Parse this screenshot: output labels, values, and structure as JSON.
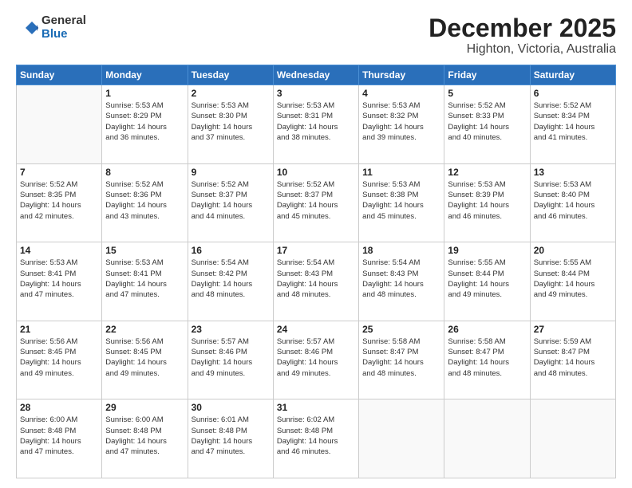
{
  "header": {
    "logo_general": "General",
    "logo_blue": "Blue",
    "month_year": "December 2025",
    "location": "Highton, Victoria, Australia"
  },
  "calendar": {
    "days_of_week": [
      "Sunday",
      "Monday",
      "Tuesday",
      "Wednesday",
      "Thursday",
      "Friday",
      "Saturday"
    ],
    "weeks": [
      [
        {
          "day": "",
          "empty": true
        },
        {
          "day": "1",
          "sunrise": "5:53 AM",
          "sunset": "8:29 PM",
          "daylight": "14 hours and 36 minutes."
        },
        {
          "day": "2",
          "sunrise": "5:53 AM",
          "sunset": "8:30 PM",
          "daylight": "14 hours and 37 minutes."
        },
        {
          "day": "3",
          "sunrise": "5:53 AM",
          "sunset": "8:31 PM",
          "daylight": "14 hours and 38 minutes."
        },
        {
          "day": "4",
          "sunrise": "5:53 AM",
          "sunset": "8:32 PM",
          "daylight": "14 hours and 39 minutes."
        },
        {
          "day": "5",
          "sunrise": "5:52 AM",
          "sunset": "8:33 PM",
          "daylight": "14 hours and 40 minutes."
        },
        {
          "day": "6",
          "sunrise": "5:52 AM",
          "sunset": "8:34 PM",
          "daylight": "14 hours and 41 minutes."
        }
      ],
      [
        {
          "day": "7",
          "sunrise": "5:52 AM",
          "sunset": "8:35 PM",
          "daylight": "14 hours and 42 minutes."
        },
        {
          "day": "8",
          "sunrise": "5:52 AM",
          "sunset": "8:36 PM",
          "daylight": "14 hours and 43 minutes."
        },
        {
          "day": "9",
          "sunrise": "5:52 AM",
          "sunset": "8:37 PM",
          "daylight": "14 hours and 44 minutes."
        },
        {
          "day": "10",
          "sunrise": "5:52 AM",
          "sunset": "8:37 PM",
          "daylight": "14 hours and 45 minutes."
        },
        {
          "day": "11",
          "sunrise": "5:53 AM",
          "sunset": "8:38 PM",
          "daylight": "14 hours and 45 minutes."
        },
        {
          "day": "12",
          "sunrise": "5:53 AM",
          "sunset": "8:39 PM",
          "daylight": "14 hours and 46 minutes."
        },
        {
          "day": "13",
          "sunrise": "5:53 AM",
          "sunset": "8:40 PM",
          "daylight": "14 hours and 46 minutes."
        }
      ],
      [
        {
          "day": "14",
          "sunrise": "5:53 AM",
          "sunset": "8:41 PM",
          "daylight": "14 hours and 47 minutes."
        },
        {
          "day": "15",
          "sunrise": "5:53 AM",
          "sunset": "8:41 PM",
          "daylight": "14 hours and 47 minutes."
        },
        {
          "day": "16",
          "sunrise": "5:54 AM",
          "sunset": "8:42 PM",
          "daylight": "14 hours and 48 minutes."
        },
        {
          "day": "17",
          "sunrise": "5:54 AM",
          "sunset": "8:43 PM",
          "daylight": "14 hours and 48 minutes."
        },
        {
          "day": "18",
          "sunrise": "5:54 AM",
          "sunset": "8:43 PM",
          "daylight": "14 hours and 48 minutes."
        },
        {
          "day": "19",
          "sunrise": "5:55 AM",
          "sunset": "8:44 PM",
          "daylight": "14 hours and 49 minutes."
        },
        {
          "day": "20",
          "sunrise": "5:55 AM",
          "sunset": "8:44 PM",
          "daylight": "14 hours and 49 minutes."
        }
      ],
      [
        {
          "day": "21",
          "sunrise": "5:56 AM",
          "sunset": "8:45 PM",
          "daylight": "14 hours and 49 minutes."
        },
        {
          "day": "22",
          "sunrise": "5:56 AM",
          "sunset": "8:45 PM",
          "daylight": "14 hours and 49 minutes."
        },
        {
          "day": "23",
          "sunrise": "5:57 AM",
          "sunset": "8:46 PM",
          "daylight": "14 hours and 49 minutes."
        },
        {
          "day": "24",
          "sunrise": "5:57 AM",
          "sunset": "8:46 PM",
          "daylight": "14 hours and 49 minutes."
        },
        {
          "day": "25",
          "sunrise": "5:58 AM",
          "sunset": "8:47 PM",
          "daylight": "14 hours and 48 minutes."
        },
        {
          "day": "26",
          "sunrise": "5:58 AM",
          "sunset": "8:47 PM",
          "daylight": "14 hours and 48 minutes."
        },
        {
          "day": "27",
          "sunrise": "5:59 AM",
          "sunset": "8:47 PM",
          "daylight": "14 hours and 48 minutes."
        }
      ],
      [
        {
          "day": "28",
          "sunrise": "6:00 AM",
          "sunset": "8:48 PM",
          "daylight": "14 hours and 47 minutes."
        },
        {
          "day": "29",
          "sunrise": "6:00 AM",
          "sunset": "8:48 PM",
          "daylight": "14 hours and 47 minutes."
        },
        {
          "day": "30",
          "sunrise": "6:01 AM",
          "sunset": "8:48 PM",
          "daylight": "14 hours and 47 minutes."
        },
        {
          "day": "31",
          "sunrise": "6:02 AM",
          "sunset": "8:48 PM",
          "daylight": "14 hours and 46 minutes."
        },
        {
          "day": "",
          "empty": true
        },
        {
          "day": "",
          "empty": true
        },
        {
          "day": "",
          "empty": true
        }
      ]
    ]
  }
}
